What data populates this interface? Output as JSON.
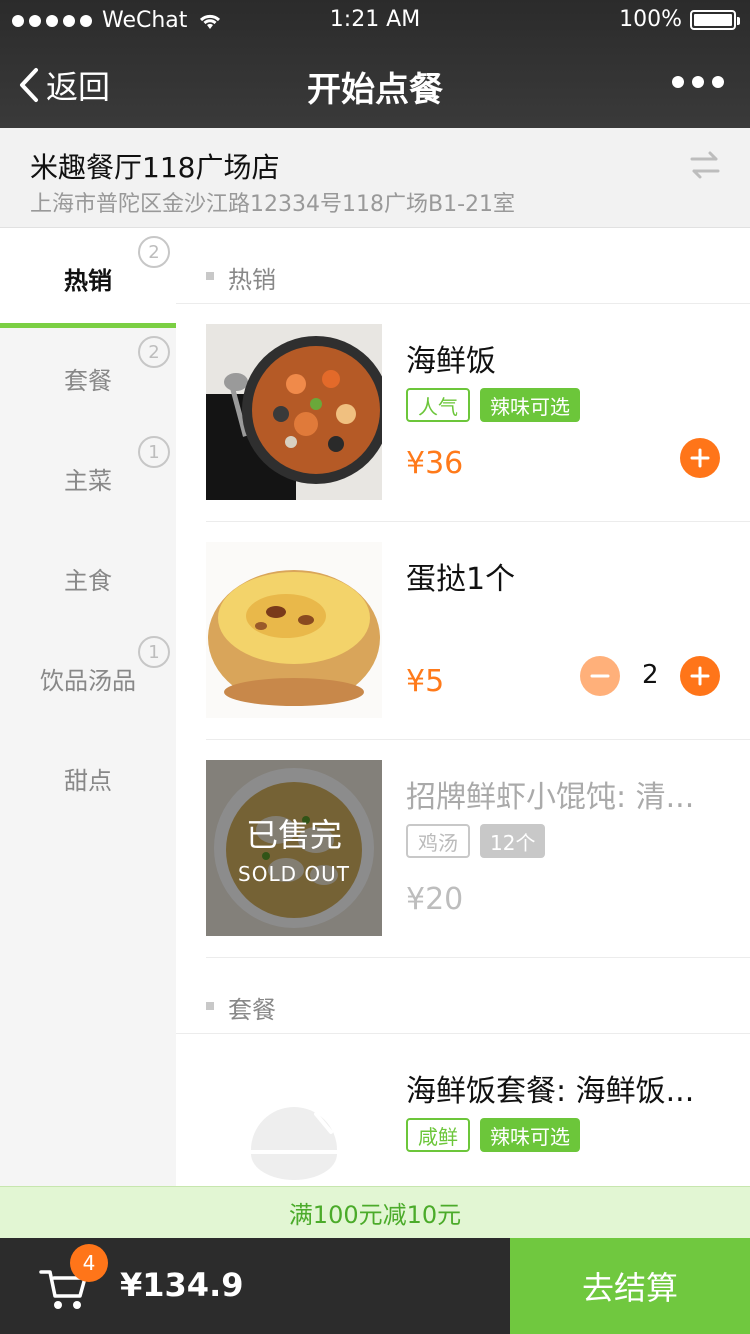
{
  "status_bar": {
    "carrier": "WeChat",
    "time": "1:21 AM",
    "battery": "100%"
  },
  "nav": {
    "back_label": "返回",
    "title": "开始点餐"
  },
  "store": {
    "name": "米趣餐厅118广场店",
    "address": "上海市普陀区金沙江路12334号118广场B1-21室"
  },
  "sidebar": {
    "items": [
      {
        "label": "热销",
        "badge": "2"
      },
      {
        "label": "套餐",
        "badge": "2"
      },
      {
        "label": "主菜",
        "badge": "1"
      },
      {
        "label": "主食",
        "badge": ""
      },
      {
        "label": "饮品汤品",
        "badge": "1"
      },
      {
        "label": "甜点",
        "badge": ""
      }
    ]
  },
  "sections": {
    "hot": {
      "title": "热销",
      "items": [
        {
          "name": "海鲜饭",
          "tags": [
            "人气",
            "辣味可选"
          ],
          "price": "¥36"
        },
        {
          "name": "蛋挞1个",
          "price": "¥5",
          "quantity": "2"
        },
        {
          "name": "招牌鲜虾小馄饨: 清...",
          "tags": [
            "鸡汤",
            "12个"
          ],
          "price": "¥20",
          "sold_out_cn": "已售完",
          "sold_out_en": "SOLD OUT"
        }
      ]
    },
    "set": {
      "title": "套餐",
      "items": [
        {
          "name": "海鲜饭套餐: 海鲜饭...",
          "tags": [
            "咸鲜",
            "辣味可选"
          ]
        }
      ]
    }
  },
  "promo": {
    "text": "满100元减10元"
  },
  "cart": {
    "count": "4",
    "total": "¥134.9",
    "checkout_label": "去结算"
  }
}
